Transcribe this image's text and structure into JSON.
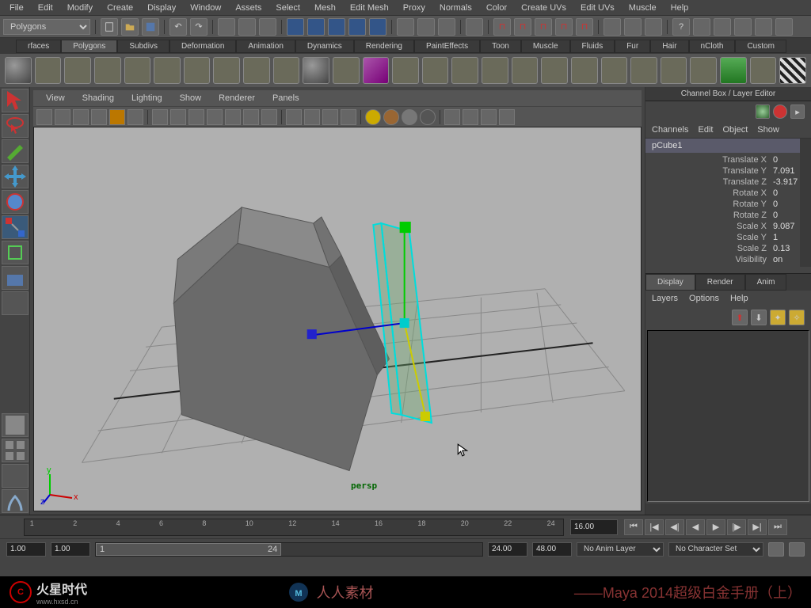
{
  "menus": {
    "file": "File",
    "edit": "Edit",
    "modify": "Modify",
    "create": "Create",
    "display": "Display",
    "window": "Window",
    "assets": "Assets",
    "select": "Select",
    "mesh": "Mesh",
    "editmesh": "Edit Mesh",
    "proxy": "Proxy",
    "normals": "Normals",
    "color": "Color",
    "createuvs": "Create UVs",
    "edituvs": "Edit UVs",
    "muscle": "Muscle",
    "help": "Help"
  },
  "mode_selector": "Polygons",
  "shelf_tabs": [
    "rfaces",
    "Polygons",
    "Subdivs",
    "Deformation",
    "Animation",
    "Dynamics",
    "Rendering",
    "PaintEffects",
    "Toon",
    "Muscle",
    "Fluids",
    "Fur",
    "Hair",
    "nCloth",
    "Custom"
  ],
  "active_shelf": "Polygons",
  "viewport_menus": {
    "view": "View",
    "shading": "Shading",
    "lighting": "Lighting",
    "show": "Show",
    "renderer": "Renderer",
    "panels": "Panels"
  },
  "viewport_label": "persp",
  "channel_box": {
    "title": "Channel Box / Layer Editor",
    "menus": {
      "channels": "Channels",
      "edit": "Edit",
      "object": "Object",
      "show": "Show"
    },
    "object": "pCube1",
    "attrs": [
      {
        "label": "Translate X",
        "val": "0"
      },
      {
        "label": "Translate Y",
        "val": "7.091"
      },
      {
        "label": "Translate Z",
        "val": "-3.917"
      },
      {
        "label": "Rotate X",
        "val": "0"
      },
      {
        "label": "Rotate Y",
        "val": "0"
      },
      {
        "label": "Rotate Z",
        "val": "0"
      },
      {
        "label": "Scale X",
        "val": "9.087"
      },
      {
        "label": "Scale Y",
        "val": "1"
      },
      {
        "label": "Scale Z",
        "val": "0.13"
      },
      {
        "label": "Visibility",
        "val": "on"
      }
    ]
  },
  "layer_editor": {
    "tabs": {
      "display": "Display",
      "render": "Render",
      "anim": "Anim"
    },
    "menus": {
      "layers": "Layers",
      "options": "Options",
      "help": "Help"
    }
  },
  "timeline": {
    "ticks": [
      "1",
      "2",
      "4",
      "6",
      "8",
      "10",
      "12",
      "14",
      "16",
      "18",
      "20",
      "22",
      "24"
    ],
    "current": "16.00"
  },
  "range": {
    "start_outer": "1.00",
    "start_inner": "1.00",
    "range_start": "1",
    "range_end": "24",
    "end_inner": "24.00",
    "end_outer": "48.00",
    "anim_layer": "No Anim Layer",
    "char_set": "No Character Set"
  },
  "footer": {
    "brand": "火星时代",
    "url": "www.hxsd.cn",
    "center": "人人素材",
    "right": "——Maya 2014超级白金手册（上）"
  }
}
